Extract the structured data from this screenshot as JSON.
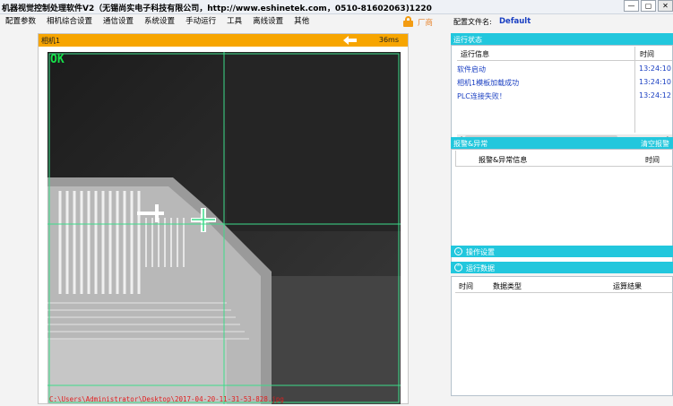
{
  "window": {
    "title": "机器视觉控制处理软件V2（无锡尚实电子科技有限公司，http://www.eshinetek.com，0510-81602063)1220",
    "buttons": [
      "—",
      "▢",
      "✕"
    ]
  },
  "menu": [
    "配置参数",
    "相机综合设置",
    "通信设置",
    "系统设置",
    "手动运行",
    "工具",
    "离线设置",
    "其他"
  ],
  "manufacturer": {
    "label": "厂商"
  },
  "config": {
    "label": "配置文件名:",
    "value": "Default"
  },
  "camera": {
    "title": "相机1",
    "time": "36ms",
    "result": "OK",
    "image_path": "C:\\Users\\Administrator\\Desktop\\2017-04-20-11-31-53-828.jpg"
  },
  "status": {
    "title": "运行状态",
    "columns": [
      "运行信息",
      "时间"
    ],
    "rows": [
      {
        "info": "软件启动",
        "time": "13:24:10"
      },
      {
        "info": "相机1模板加载成功",
        "time": "13:24:10"
      },
      {
        "info": "PLC连接失败！",
        "time": "13:24:12"
      }
    ]
  },
  "alarm": {
    "title": "报警&异常",
    "action": "清空报警",
    "columns": [
      "报警&异常信息",
      "时间"
    ]
  },
  "operation": {
    "title": "操作设置",
    "icon": "chevron-down-icon"
  },
  "run_data": {
    "title": "运行数据",
    "icon": "chevron-up-icon",
    "columns": [
      "时间",
      "数据类型",
      "运算结果"
    ]
  },
  "colors": {
    "accent_orange": "#f7a500",
    "accent_cyan": "#22c7dd",
    "ok_green": "#15e24a",
    "crosshair": "#3ddc8a"
  }
}
